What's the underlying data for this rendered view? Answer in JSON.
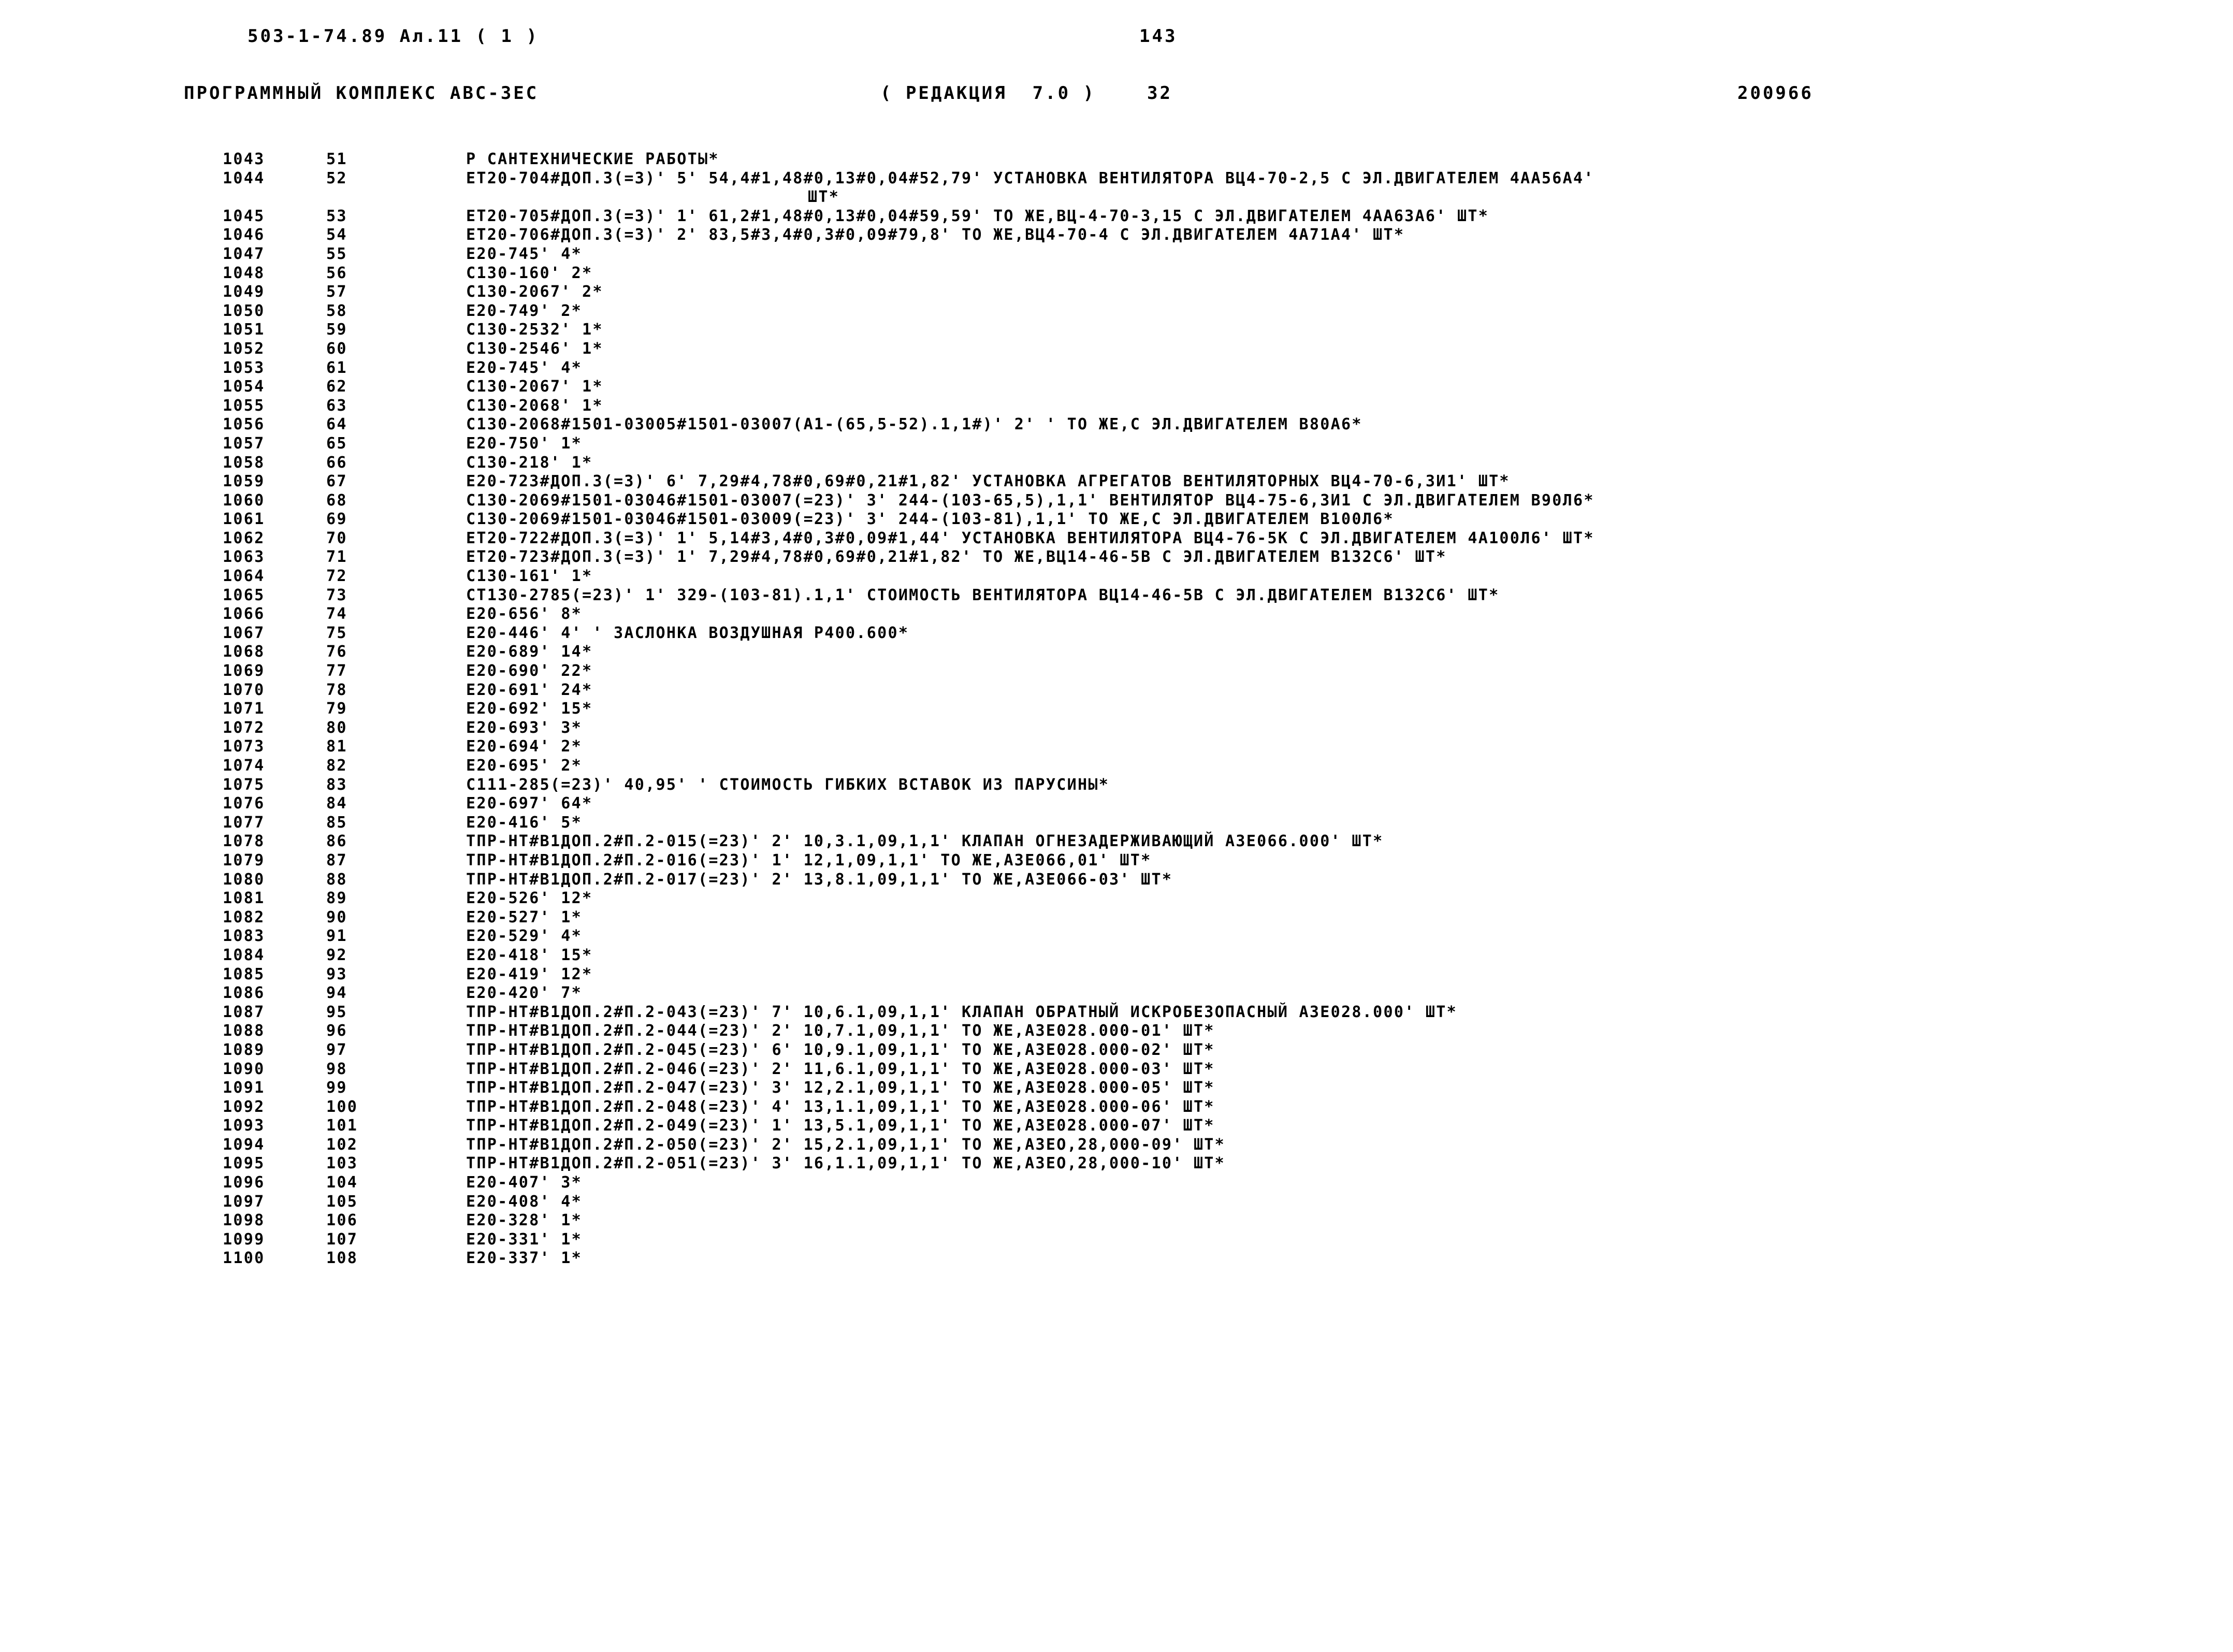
{
  "header": {
    "doc_code": "503-1-74.89 Ал.11 ( 1 )",
    "page_number": "143",
    "complex_title": "ПРОГРАММНЫЙ КОМПЛЕКС АВС-3ЕС",
    "revision": "( РЕДАКЦИЯ  7.0 )",
    "sheet_number": "32",
    "doc_id": "200966"
  },
  "listing": {
    "rows": [
      {
        "seq": "1043",
        "num": "51",
        "text": "Р САНТЕХНИЧЕСКИЕ РАБОТЫ*"
      },
      {
        "seq": "1044",
        "num": "52",
        "text": "ЕТ20-704#ДОП.3(=3)' 5' 54,4#1,48#0,13#0,04#52,79' УСТАНОВКА ВЕНТИЛЯТОРА ВЦ4-70-2,5 С ЭЛ.ДВИГАТЕЛЕМ 4АА56А4'"
      },
      {
        "seq": "",
        "num": "",
        "text": "ШТ*",
        "continuation": true,
        "indent": 1130
      },
      {
        "seq": "1045",
        "num": "53",
        "text": "ЕТ20-705#ДОП.3(=3)' 1' 61,2#1,48#0,13#0,04#59,59' ТО ЖЕ,ВЦ-4-70-3,15 С ЭЛ.ДВИГАТЕЛЕМ 4АА63А6' ШТ*"
      },
      {
        "seq": "1046",
        "num": "54",
        "text": "ЕТ20-706#ДОП.3(=3)' 2' 83,5#3,4#0,3#0,09#79,8' ТО ЖЕ,ВЦ4-70-4 С ЭЛ.ДВИГАТЕЛЕМ 4А71А4' ШТ*"
      },
      {
        "seq": "1047",
        "num": "55",
        "text": "Е20-745' 4*"
      },
      {
        "seq": "1048",
        "num": "56",
        "text": "С130-160' 2*"
      },
      {
        "seq": "1049",
        "num": "57",
        "text": "С130-2067' 2*"
      },
      {
        "seq": "1050",
        "num": "58",
        "text": "Е20-749' 2*"
      },
      {
        "seq": "1051",
        "num": "59",
        "text": "С130-2532' 1*"
      },
      {
        "seq": "1052",
        "num": "60",
        "text": "С130-2546' 1*"
      },
      {
        "seq": "1053",
        "num": "61",
        "text": "Е20-745' 4*"
      },
      {
        "seq": "1054",
        "num": "62",
        "text": "С130-2067' 1*"
      },
      {
        "seq": "1055",
        "num": "63",
        "text": "С130-2068' 1*"
      },
      {
        "seq": "1056",
        "num": "64",
        "text": "С130-2068#1501-03005#1501-03007(А1-(65,5-52).1,1#)' 2' ' ТО ЖЕ,С ЭЛ.ДВИГАТЕЛЕМ В80А6*"
      },
      {
        "seq": "1057",
        "num": "65",
        "text": "Е20-750' 1*"
      },
      {
        "seq": "1058",
        "num": "66",
        "text": "С130-218' 1*"
      },
      {
        "seq": "1059",
        "num": "67",
        "text": "Е20-723#ДОП.3(=3)' 6' 7,29#4,78#0,69#0,21#1,82' УСТАНОВКА АГРЕГАТОВ ВЕНТИЛЯТОРНЫХ ВЦ4-70-6,3И1' ШТ*"
      },
      {
        "seq": "1060",
        "num": "68",
        "text": "С130-2069#1501-03046#1501-03007(=23)' 3' 244-(103-65,5),1,1' ВЕНТИЛЯТОР ВЦ4-75-6,3И1 С ЭЛ.ДВИГАТЕЛЕМ В90Л6*"
      },
      {
        "seq": "1061",
        "num": "69",
        "text": "С130-2069#1501-03046#1501-03009(=23)' 3' 244-(103-81),1,1' ТО ЖЕ,С ЭЛ.ДВИГАТЕЛЕМ В100Л6*"
      },
      {
        "seq": "1062",
        "num": "70",
        "text": "ЕТ20-722#ДОП.3(=3)' 1' 5,14#3,4#0,3#0,09#1,44' УСТАНОВКА ВЕНТИЛЯТОРА ВЦ4-76-5К С ЭЛ.ДВИГАТЕЛЕМ 4А100Л6' ШТ*"
      },
      {
        "seq": "1063",
        "num": "71",
        "text": "ЕТ20-723#ДОП.3(=3)' 1' 7,29#4,78#0,69#0,21#1,82' ТО ЖЕ,ВЦ14-46-5В С ЭЛ.ДВИГАТЕЛЕМ В132С6' ШТ*"
      },
      {
        "seq": "1064",
        "num": "72",
        "text": "С130-161' 1*"
      },
      {
        "seq": "1065",
        "num": "73",
        "text": "СТ130-2785(=23)' 1' 329-(103-81).1,1' СТОИМОСТЬ ВЕНТИЛЯТОРА ВЦ14-46-5В С ЭЛ.ДВИГАТЕЛЕМ В132С6' ШТ*"
      },
      {
        "seq": "1066",
        "num": "74",
        "text": "Е20-656' 8*"
      },
      {
        "seq": "1067",
        "num": "75",
        "text": "Е20-446' 4' ' ЗАСЛОНКА ВОЗДУШНАЯ Р400.600*"
      },
      {
        "seq": "1068",
        "num": "76",
        "text": "Е20-689' 14*"
      },
      {
        "seq": "1069",
        "num": "77",
        "text": "Е20-690' 22*"
      },
      {
        "seq": "1070",
        "num": "78",
        "text": "Е20-691' 24*"
      },
      {
        "seq": "1071",
        "num": "79",
        "text": "Е20-692' 15*"
      },
      {
        "seq": "1072",
        "num": "80",
        "text": "Е20-693' 3*"
      },
      {
        "seq": "1073",
        "num": "81",
        "text": "Е20-694' 2*"
      },
      {
        "seq": "1074",
        "num": "82",
        "text": "Е20-695' 2*"
      },
      {
        "seq": "1075",
        "num": "83",
        "text": "С111-285(=23)' 40,95' ' СТОИМОСТЬ ГИБКИХ ВСТАВОК ИЗ ПАРУСИНЫ*"
      },
      {
        "seq": "1076",
        "num": "84",
        "text": "Е20-697' 64*"
      },
      {
        "seq": "1077",
        "num": "85",
        "text": "Е20-416' 5*"
      },
      {
        "seq": "1078",
        "num": "86",
        "text": "ТПР-НТ#В1ДОП.2#П.2-015(=23)' 2' 10,3.1,09,1,1' КЛАПАН ОГНЕЗАДЕРЖИВАЮЩИЙ АЗЕ066.000' ШТ*"
      },
      {
        "seq": "1079",
        "num": "87",
        "text": "ТПР-НТ#В1ДОП.2#П.2-016(=23)' 1' 12,1,09,1,1' ТО ЖЕ,АЗЕ066,01' ШТ*"
      },
      {
        "seq": "1080",
        "num": "88",
        "text": "ТПР-НТ#В1ДОП.2#П.2-017(=23)' 2' 13,8.1,09,1,1' ТО ЖЕ,АЗЕ066-03' ШТ*"
      },
      {
        "seq": "1081",
        "num": "89",
        "text": "Е20-526' 12*"
      },
      {
        "seq": "1082",
        "num": "90",
        "text": "Е20-527' 1*"
      },
      {
        "seq": "1083",
        "num": "91",
        "text": "Е20-529' 4*"
      },
      {
        "seq": "1084",
        "num": "92",
        "text": "Е20-418' 15*"
      },
      {
        "seq": "1085",
        "num": "93",
        "text": "Е20-419' 12*"
      },
      {
        "seq": "1086",
        "num": "94",
        "text": "Е20-420' 7*"
      },
      {
        "seq": "1087",
        "num": "95",
        "text": "ТПР-НТ#В1ДОП.2#П.2-043(=23)' 7' 10,6.1,09,1,1' КЛАПАН ОБРАТНЫЙ ИСКРОБЕЗОПАСНЫЙ АЗЕ028.000' ШТ*"
      },
      {
        "seq": "1088",
        "num": "96",
        "text": "ТПР-НТ#В1ДОП.2#П.2-044(=23)' 2' 10,7.1,09,1,1' ТО ЖЕ,АЗЕ028.000-01' ШТ*"
      },
      {
        "seq": "1089",
        "num": "97",
        "text": "ТПР-НТ#В1ДОП.2#П.2-045(=23)' 6' 10,9.1,09,1,1' ТО ЖЕ,АЗЕ028.000-02' ШТ*"
      },
      {
        "seq": "1090",
        "num": "98",
        "text": "ТПР-НТ#В1ДОП.2#П.2-046(=23)' 2' 11,6.1,09,1,1' ТО ЖЕ,АЗЕ028.000-03' ШТ*"
      },
      {
        "seq": "1091",
        "num": "99",
        "text": "ТПР-НТ#В1ДОП.2#П.2-047(=23)' 3' 12,2.1,09,1,1' ТО ЖЕ,АЗЕ028.000-05' ШТ*"
      },
      {
        "seq": "1092",
        "num": "100",
        "text": "ТПР-НТ#В1ДОП.2#П.2-048(=23)' 4' 13,1.1,09,1,1' ТО ЖЕ,АЗЕ028.000-06' ШТ*"
      },
      {
        "seq": "1093",
        "num": "101",
        "text": "ТПР-НТ#В1ДОП.2#П.2-049(=23)' 1' 13,5.1,09,1,1' ТО ЖЕ,АЗЕ028.000-07' ШТ*"
      },
      {
        "seq": "1094",
        "num": "102",
        "text": "ТПР-НТ#В1ДОП.2#П.2-050(=23)' 2' 15,2.1,09,1,1' ТО ЖЕ,АЗЕО,28,000-09' ШТ*"
      },
      {
        "seq": "1095",
        "num": "103",
        "text": "ТПР-НТ#В1ДОП.2#П.2-051(=23)' 3' 16,1.1,09,1,1' ТО ЖЕ,АЗЕО,28,000-10' ШТ*"
      },
      {
        "seq": "1096",
        "num": "104",
        "text": "Е20-407' 3*"
      },
      {
        "seq": "1097",
        "num": "105",
        "text": "Е20-408' 4*"
      },
      {
        "seq": "1098",
        "num": "106",
        "text": "Е20-328' 1*"
      },
      {
        "seq": "1099",
        "num": "107",
        "text": "Е20-331' 1*"
      },
      {
        "seq": "1100",
        "num": "108",
        "text": "Е20-337' 1*"
      }
    ]
  }
}
